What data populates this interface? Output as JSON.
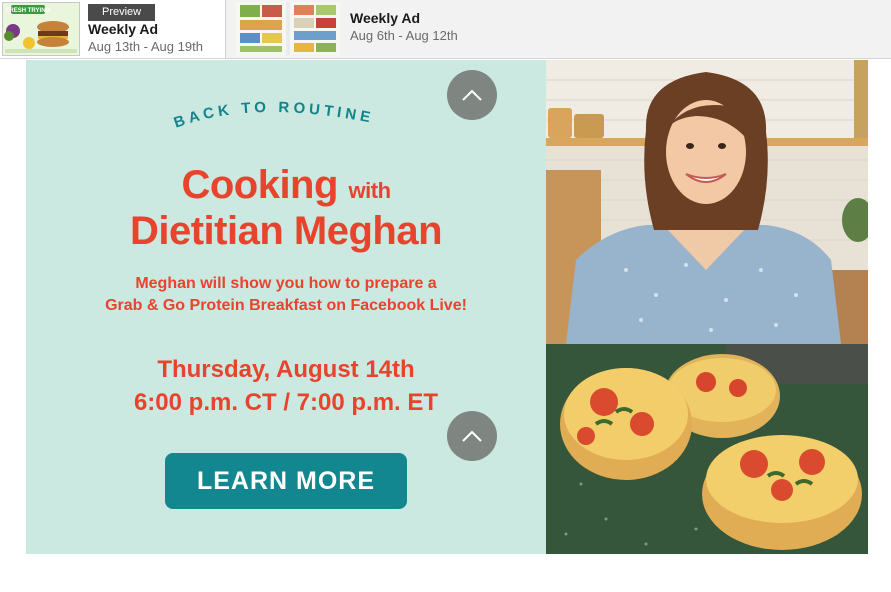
{
  "tabs": [
    {
      "badge": "Preview",
      "title": "Weekly Ad",
      "dates": "Aug 13th - Aug 19th",
      "thumb_text": "FRESH TRYING"
    },
    {
      "title": "Weekly Ad",
      "dates": "Aug 6th - Aug 12th"
    }
  ],
  "banner": {
    "kicker": "BACK TO ROUTINE",
    "headline_main": "Cooking",
    "headline_with": "with",
    "headline_name": "Dietitian Meghan",
    "description_line1": "Meghan will show you how to prepare a",
    "description_line2": "Grab & Go Protein Breakfast on Facebook Live!",
    "date_line": "Thursday, August 14th",
    "time_line": "6:00 p.m. CT / 7:00 p.m. ET",
    "cta_label": "LEARN MORE"
  },
  "icons": {
    "scroll_up": "chevron-up-icon"
  },
  "colors": {
    "panel_bg": "#cbe9e1",
    "headline": "#e8432d",
    "kicker": "#13838c",
    "cta_bg": "#12878f",
    "scroll_btn": "#7f8580"
  }
}
